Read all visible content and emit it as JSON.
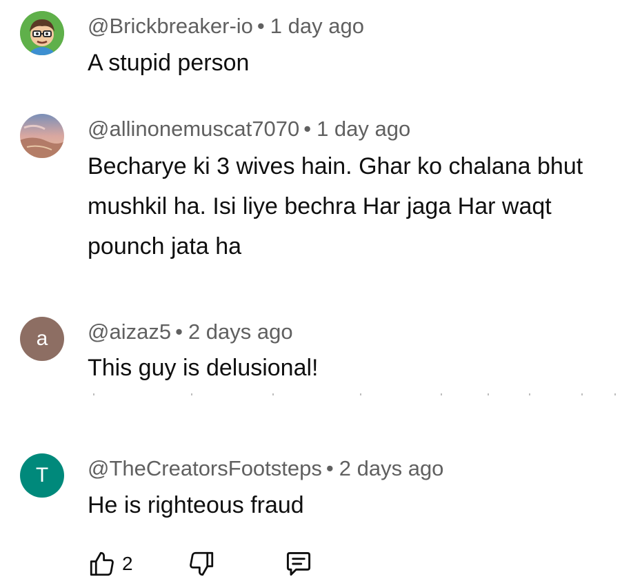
{
  "comments": [
    {
      "handle": "@Brickbreaker-io",
      "separator": "•",
      "time": "1 day ago",
      "text": "A stupid person",
      "avatar": {
        "type": "image",
        "icon": "cartoon-avatar-icon",
        "bg": "#5fb04a"
      }
    },
    {
      "handle": "@allinonemuscat7070",
      "separator": "•",
      "time": "1 day ago",
      "text": "Becharye ki 3 wives hain. Ghar ko chalana bhut mushkil ha. Isi liye bechra Har jaga Har waqt pounch jata ha",
      "avatar": {
        "type": "image",
        "icon": "sky-photo-avatar-icon",
        "bg": "#c9a58c"
      }
    },
    {
      "handle": "@aizaz5",
      "separator": "•",
      "time": "2 days ago",
      "text": "This guy is delusional!",
      "avatar": {
        "type": "letter",
        "letter": "a",
        "bg": "#8d6e63"
      }
    },
    {
      "handle": "@TheCreatorsFootsteps",
      "separator": "•",
      "time": "2 days ago",
      "text": "He is righteous fraud",
      "avatar": {
        "type": "letter",
        "letter": "T",
        "bg": "#00897b"
      }
    }
  ],
  "actions": {
    "like_icon": "thumbs-up-icon",
    "like_count": "2",
    "dislike_icon": "thumbs-down-icon",
    "reply_icon": "reply-comment-icon"
  },
  "colors": {
    "text_primary": "#0f0f0f",
    "text_secondary": "#606060"
  }
}
